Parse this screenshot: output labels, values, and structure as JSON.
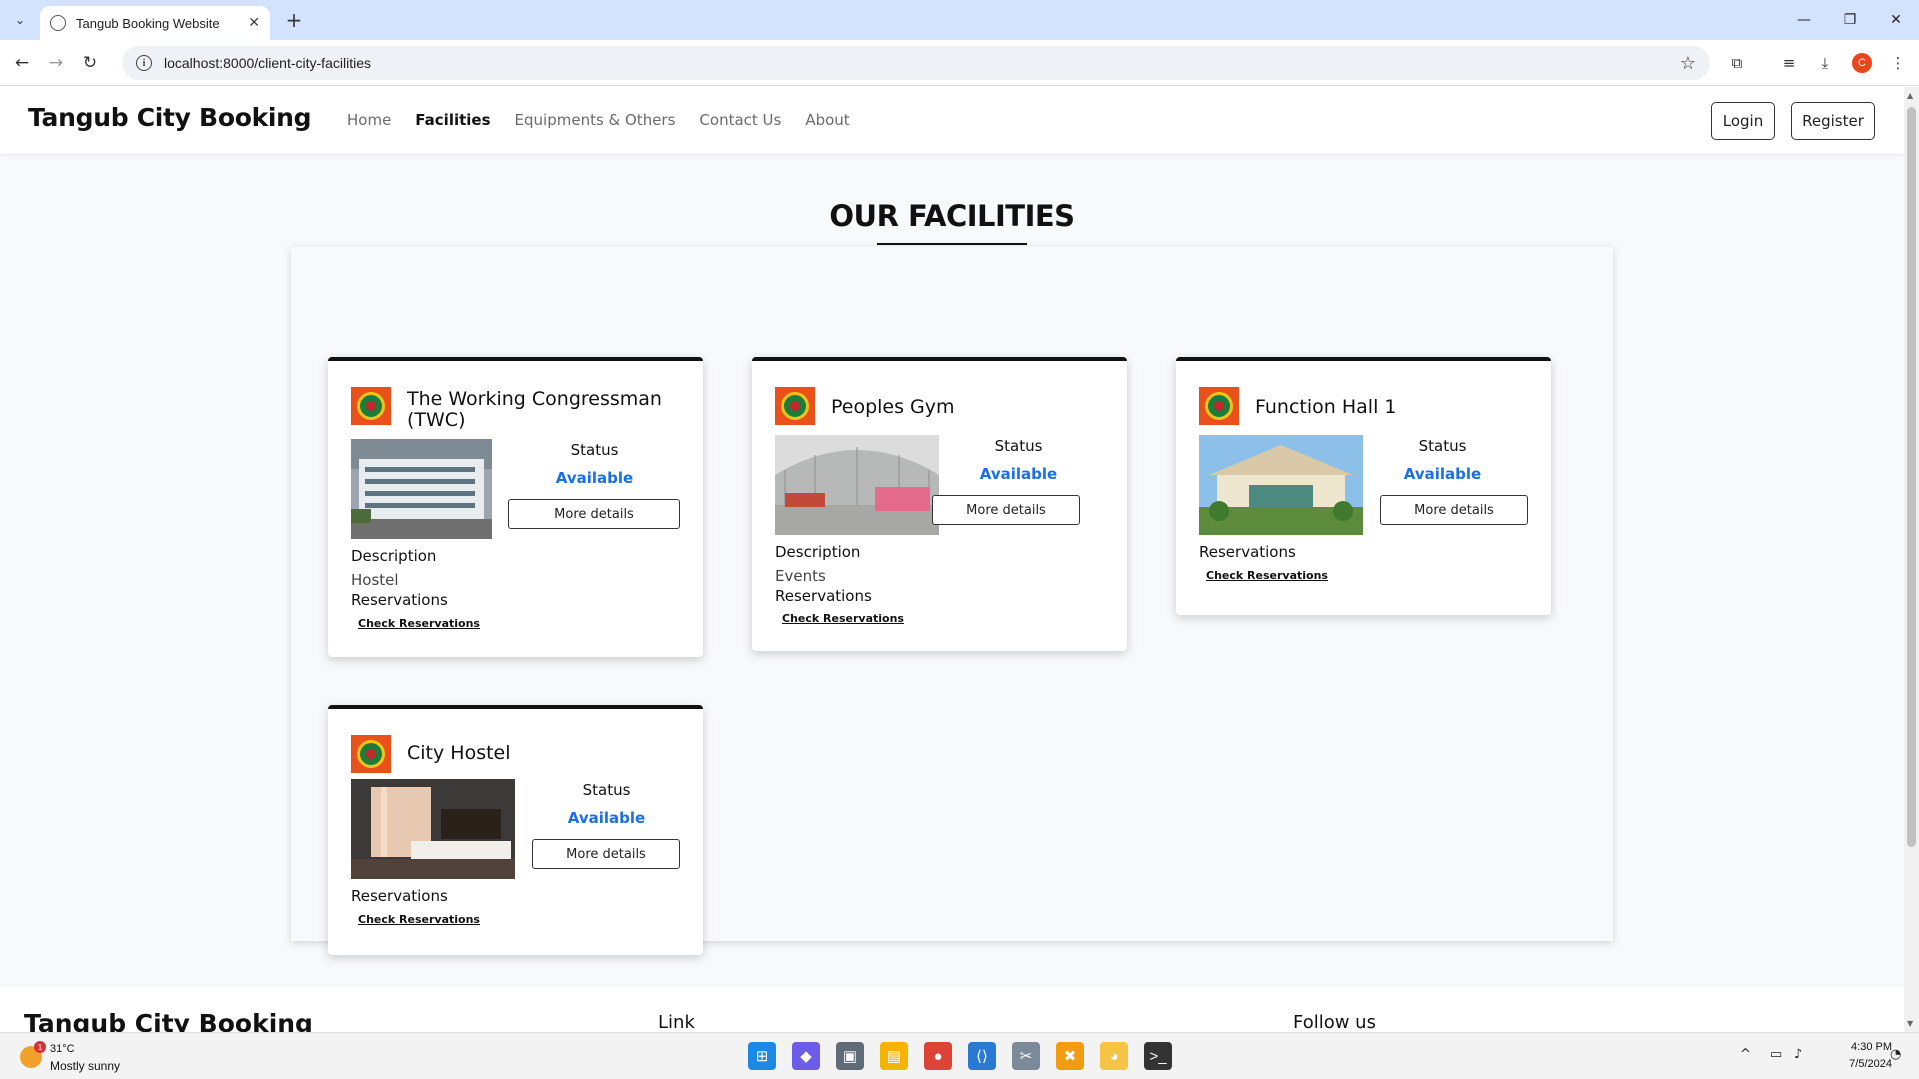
{
  "browser": {
    "tab_title": "Tangub Booking Website",
    "url": "localhost:8000/client-city-facilities"
  },
  "site": {
    "brand": "Tangub City Booking",
    "nav": [
      "Home",
      "Facilities",
      "Equipments & Others",
      "Contact Us",
      "About"
    ],
    "active_nav": "Facilities",
    "login": "Login",
    "register": "Register"
  },
  "page": {
    "title": "OUR FACILITIES"
  },
  "labels": {
    "status": "Status",
    "description": "Description",
    "reservations": "Reservations",
    "check_reservations": "Check Reservations",
    "more_details": "More details"
  },
  "facilities": [
    {
      "name": "The Working Congressman (TWC)",
      "status": "Available",
      "description": "Hostel"
    },
    {
      "name": "Peoples Gym",
      "status": "Available",
      "description": "Events"
    },
    {
      "name": "Function Hall 1",
      "status": "Available"
    },
    {
      "name": "City Hostel",
      "status": "Available"
    }
  ],
  "footer": {
    "brand": "Tangub City Booking",
    "link_heading": "Link",
    "follow_heading": "Follow us"
  },
  "taskbar": {
    "weather_temp": "31°C",
    "weather_desc": "Mostly sunny",
    "weather_badge": "1",
    "time": "4:30 PM",
    "date": "7/5/2024"
  },
  "colors": {
    "status_available": "#1a6fe8",
    "card_top_border": "#111111",
    "tabbar": "#d3e3fd"
  }
}
